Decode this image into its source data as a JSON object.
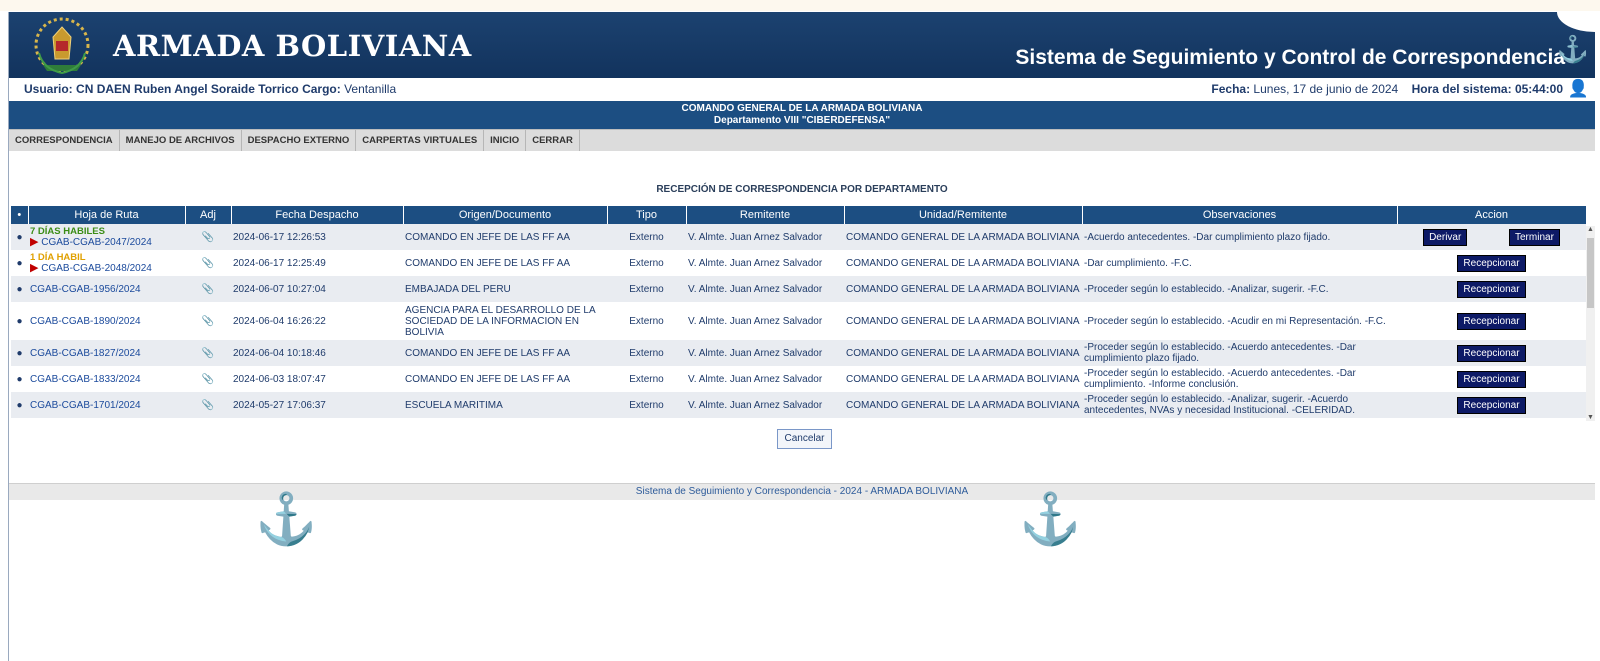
{
  "header": {
    "brand": "ARMADA BOLIVIANA",
    "system_title": "Sistema de Seguimiento y Control de Correspondencia"
  },
  "user": {
    "usuario_label": "Usuario:",
    "usuario_value": "CN DAEN Ruben Angel Soraide Torrico",
    "cargo_label": "Cargo:",
    "cargo_value": "Ventanilla",
    "fecha_label": "Fecha:",
    "fecha_value": "Lunes, 17 de junio de 2024",
    "hora_label": "Hora del sistema:",
    "hora_value": "05:44:00"
  },
  "org": {
    "line1": "COMANDO GENERAL DE LA ARMADA BOLIVIANA",
    "line2": "Departamento VIII \"CIBERDEFENSA\""
  },
  "tabs": [
    "CORRESPONDENCIA",
    "MANEJO DE ARCHIVOS",
    "DESPACHO EXTERNO",
    "CARPERTAS VIRTUALES",
    "INICIO",
    "CERRAR"
  ],
  "section_title": "RECEPCIÓN DE CORRESPONDENCIA POR DEPARTAMENTO",
  "columns": [
    "•",
    "Hoja de Ruta",
    "Adj",
    "Fecha Despacho",
    "Origen/Documento",
    "Tipo",
    "Remitente",
    "Unidad/Remitente",
    "Observaciones",
    "Accion"
  ],
  "rows": [
    {
      "badge": "7 DÍAS HABILES",
      "hoja": "CGAB-CGAB-2047/2024",
      "fecha": "2024-06-17 12:26:53",
      "origen": "COMANDO EN JEFE DE LAS FF AA",
      "tipo": "Externo",
      "remitente": "V. Almte. Juan Arnez Salvador",
      "unidad": "COMANDO GENERAL DE LA ARMADA BOLIVIANA",
      "obs": "-Acuerdo antecedentes. -Dar cumplimiento plazo fijado.",
      "actions": [
        "Derivar",
        "Terminar"
      ]
    },
    {
      "badge": "1 DÍA HABIL",
      "hoja": "CGAB-CGAB-2048/2024",
      "fecha": "2024-06-17 12:25:49",
      "origen": "COMANDO EN JEFE DE LAS FF AA",
      "tipo": "Externo",
      "remitente": "V. Almte. Juan Arnez Salvador",
      "unidad": "COMANDO GENERAL DE LA ARMADA BOLIVIANA",
      "obs": "-Dar cumplimiento. -F.C.",
      "actions": [
        "Recepcionar"
      ]
    },
    {
      "hoja": "CGAB-CGAB-1956/2024",
      "fecha": "2024-06-07 10:27:04",
      "origen": "EMBAJADA DEL PERU",
      "tipo": "Externo",
      "remitente": "V. Almte. Juan Arnez Salvador",
      "unidad": "COMANDO GENERAL DE LA ARMADA BOLIVIANA",
      "obs": "-Proceder según lo establecido. -Analizar, sugerir. -F.C.",
      "actions": [
        "Recepcionar"
      ]
    },
    {
      "hoja": "CGAB-CGAB-1890/2024",
      "fecha": "2024-06-04 16:26:22",
      "origen": "AGENCIA PARA EL DESARROLLO DE LA SOCIEDAD DE LA INFORMACION EN BOLIVIA",
      "tipo": "Externo",
      "remitente": "V. Almte. Juan Arnez Salvador",
      "unidad": "COMANDO GENERAL DE LA ARMADA BOLIVIANA",
      "obs": "-Proceder según lo establecido. -Acudir en mi Representación. -F.C.",
      "actions": [
        "Recepcionar"
      ]
    },
    {
      "hoja": "CGAB-CGAB-1827/2024",
      "fecha": "2024-06-04 10:18:46",
      "origen": "COMANDO EN JEFE DE LAS FF AA",
      "tipo": "Externo",
      "remitente": "V. Almte. Juan Arnez Salvador",
      "unidad": "COMANDO GENERAL DE LA ARMADA BOLIVIANA",
      "obs": "-Proceder según lo establecido. -Acuerdo antecedentes. -Dar cumplimiento plazo fijado.",
      "actions": [
        "Recepcionar"
      ]
    },
    {
      "hoja": "CGAB-CGAB-1833/2024",
      "fecha": "2024-06-03 18:07:47",
      "origen": "COMANDO EN JEFE DE LAS FF AA",
      "tipo": "Externo",
      "remitente": "V. Almte. Juan Arnez Salvador",
      "unidad": "COMANDO GENERAL DE LA ARMADA BOLIVIANA",
      "obs": "-Proceder según lo establecido. -Acuerdo antecedentes. -Dar cumplimiento. -Informe conclusión.",
      "actions": [
        "Recepcionar"
      ]
    },
    {
      "hoja": "CGAB-CGAB-1701/2024",
      "fecha": "2024-05-27 17:06:37",
      "origen": "ESCUELA MARITIMA",
      "tipo": "Externo",
      "remitente": "V. Almte. Juan Arnez Salvador",
      "unidad": "COMANDO GENERAL DE LA ARMADA BOLIVIANA",
      "obs": "-Proceder según lo establecido. -Analizar, sugerir. -Acuerdo antecedentes, NVAs y necesidad Institucional. -CELERIDAD.",
      "actions": [
        "Recepcionar"
      ]
    }
  ],
  "cancel_label": "Cancelar",
  "footer": "Sistema de Seguimiento y Correspondencia - 2024 - ARMADA BOLIVIANA"
}
